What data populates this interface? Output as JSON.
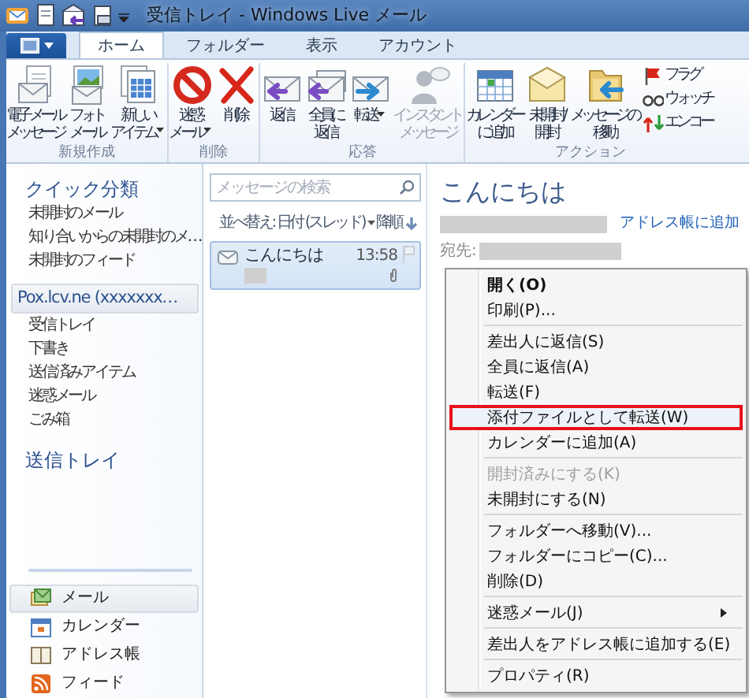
{
  "window": {
    "title": "受信トレイ - Windows Live メール"
  },
  "tabs": [
    {
      "label": "ホーム",
      "selected": true
    },
    {
      "label": "フォルダー",
      "selected": false
    },
    {
      "label": "表示",
      "selected": false
    },
    {
      "label": "アカウント",
      "selected": false
    }
  ],
  "ribbon": {
    "groups": [
      {
        "label": "新規作成",
        "buttons": [
          {
            "lines": [
              "電子メール",
              "メッセージ"
            ],
            "dropdown": false,
            "disabled": false
          },
          {
            "lines": [
              "フォト",
              "メール"
            ],
            "dropdown": false,
            "disabled": false
          },
          {
            "lines": [
              "新しい",
              "アイテム"
            ],
            "dropdown": true,
            "disabled": false
          }
        ]
      },
      {
        "label": "削除",
        "buttons": [
          {
            "lines": [
              "迷惑",
              "メール"
            ],
            "dropdown": true,
            "disabled": false
          },
          {
            "lines": [
              "削除"
            ],
            "dropdown": false,
            "disabled": false
          }
        ]
      },
      {
        "label": "応答",
        "buttons": [
          {
            "lines": [
              "返信"
            ],
            "dropdown": false,
            "disabled": false
          },
          {
            "lines": [
              "全員に",
              "返信"
            ],
            "dropdown": false,
            "disabled": false
          },
          {
            "lines": [
              "転送"
            ],
            "dropdown": true,
            "disabled": false
          },
          {
            "lines": [
              "インスタント",
              "メッセージ"
            ],
            "dropdown": false,
            "disabled": true
          }
        ]
      },
      {
        "label": "アクション",
        "buttons": [
          {
            "lines": [
              "カレンダー",
              "に追加"
            ],
            "dropdown": false,
            "disabled": false
          },
          {
            "lines": [
              "未開封/",
              "開封"
            ],
            "dropdown": false,
            "disabled": false
          },
          {
            "lines": [
              "メッセージの",
              "移動"
            ],
            "dropdown": false,
            "disabled": false
          }
        ],
        "small_buttons": [
          {
            "label": "フラグ"
          },
          {
            "label": "ウォッチ"
          },
          {
            "label": "エンコー"
          }
        ]
      }
    ]
  },
  "sidebar": {
    "quick_views": {
      "title": "クイック分類",
      "items": [
        {
          "label": "未開封のメール",
          "selected": false
        },
        {
          "label": "知り合いからの未開封のメ…",
          "selected": false
        },
        {
          "label": "未開封のフィード",
          "selected": false
        }
      ]
    },
    "account": {
      "name": "Pox.lcv.ne (xxxxxxx…",
      "selected": true,
      "folders": [
        {
          "label": "受信トレイ",
          "selected": false
        },
        {
          "label": "下書き",
          "selected": false
        },
        {
          "label": "送信済みアイテム",
          "selected": false
        },
        {
          "label": "迷惑メール",
          "selected": false
        },
        {
          "label": "ごみ箱",
          "selected": false
        }
      ]
    },
    "outbox": "送信トレイ",
    "nav": [
      {
        "label": "メール",
        "selected": true
      },
      {
        "label": "カレンダー",
        "selected": false
      },
      {
        "label": "アドレス帳",
        "selected": false
      },
      {
        "label": "フィード",
        "selected": false
      }
    ]
  },
  "message_list": {
    "search": {
      "placeholder": "メッセージの検索"
    },
    "sort": "並べ替え: 日付 (スレッド)",
    "sort_order": "降順",
    "messages": [
      {
        "subject": "こんにちは",
        "time": "13:58",
        "selected": true,
        "attachment": true
      }
    ]
  },
  "reading_pane": {
    "subject": "こんにちは",
    "add_contact_link": "アドレス帳に追加",
    "to_label": "宛先:"
  },
  "context_menu": {
    "items": [
      {
        "kind": "item",
        "label": "開く(O)",
        "default": true,
        "disabled": false,
        "selected": false,
        "submenu": false
      },
      {
        "kind": "item",
        "label": "印刷(P)...",
        "default": false,
        "disabled": false,
        "selected": false,
        "submenu": false
      },
      {
        "kind": "separator"
      },
      {
        "kind": "item",
        "label": "差出人に返信(S)",
        "default": false,
        "disabled": false,
        "selected": false,
        "submenu": false
      },
      {
        "kind": "item",
        "label": "全員に返信(A)",
        "default": false,
        "disabled": false,
        "selected": false,
        "submenu": false
      },
      {
        "kind": "item",
        "label": "転送(F)",
        "default": false,
        "disabled": false,
        "selected": false,
        "submenu": false
      },
      {
        "kind": "item",
        "label": "添付ファイルとして転送(W)",
        "default": false,
        "disabled": false,
        "selected": true,
        "submenu": false
      },
      {
        "kind": "item",
        "label": "カレンダーに追加(A)",
        "default": false,
        "disabled": false,
        "selected": false,
        "submenu": false
      },
      {
        "kind": "separator"
      },
      {
        "kind": "item",
        "label": "開封済みにする(K)",
        "default": false,
        "disabled": true,
        "selected": false,
        "submenu": false
      },
      {
        "kind": "item",
        "label": "未開封にする(N)",
        "default": false,
        "disabled": false,
        "selected": false,
        "submenu": false
      },
      {
        "kind": "separator"
      },
      {
        "kind": "item",
        "label": "フォルダーへ移動(V)...",
        "default": false,
        "disabled": false,
        "selected": false,
        "submenu": false
      },
      {
        "kind": "item",
        "label": "フォルダーにコピー(C)...",
        "default": false,
        "disabled": false,
        "selected": false,
        "submenu": false
      },
      {
        "kind": "item",
        "label": "削除(D)",
        "default": false,
        "disabled": false,
        "selected": false,
        "submenu": false
      },
      {
        "kind": "separator"
      },
      {
        "kind": "item",
        "label": "迷惑メール(J)",
        "default": false,
        "disabled": false,
        "selected": false,
        "submenu": true
      },
      {
        "kind": "separator"
      },
      {
        "kind": "item",
        "label": "差出人をアドレス帳に追加する(E)",
        "default": false,
        "disabled": false,
        "selected": false,
        "submenu": false
      },
      {
        "kind": "separator"
      },
      {
        "kind": "item",
        "label": "プロパティ(R)",
        "default": false,
        "disabled": false,
        "selected": false,
        "submenu": false
      }
    ]
  }
}
